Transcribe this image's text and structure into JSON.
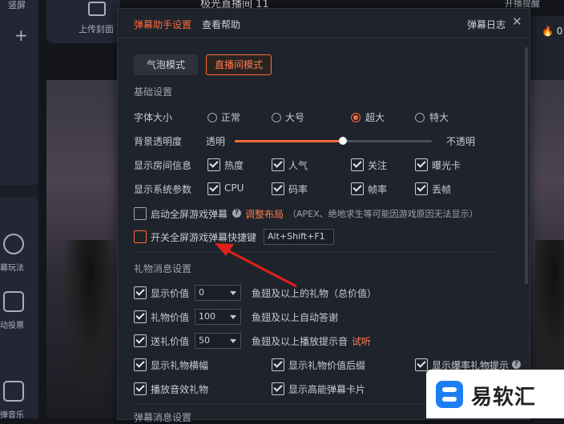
{
  "background": {
    "left_top_label": "竖屏",
    "upload_cover": "上传封面",
    "stream_title": "极光直播间 11",
    "right_top": "开播提醒",
    "right_count": "0",
    "side_items": [
      "幕玩法",
      "动投票",
      "弹音乐"
    ]
  },
  "dialog": {
    "tabs": {
      "settings": "弹幕助手设置",
      "help": "查看帮助"
    },
    "log": "弹幕日志",
    "close": "✕",
    "modes": [
      "气泡模式",
      "直播间模式"
    ],
    "basic": {
      "title": "基础设置",
      "font_label": "字体大小",
      "font_options": [
        "正常",
        "大号",
        "超大",
        "特大"
      ],
      "font_selected": "超大",
      "opacity_label": "背景透明度",
      "opacity_min": "透明",
      "opacity_max": "不透明",
      "opacity_value": 0.55,
      "room_label": "显示房间信息",
      "room_options": [
        "热度",
        "人气",
        "关注",
        "曝光卡"
      ],
      "sys_label": "显示系统参数",
      "sys_options": [
        "CPU",
        "码率",
        "帧率",
        "丢帧"
      ],
      "fullscreen_label": "启动全屏游戏弹幕",
      "adjust_layout": "调整布局",
      "fullscreen_note": "（APEX、绝地求生等可能因游戏原因无法显示）",
      "hotkey_label": "开关全屏游戏弹幕快捷键",
      "hotkey_value": "Alt+Shift+F1"
    },
    "gift": {
      "title": "礼物消息设置",
      "show_value_label": "显示价值",
      "show_value": "0",
      "show_value_suffix": "鱼翅及以上的礼物（总价值）",
      "gift_value_label": "礼物价值",
      "gift_value": "100",
      "gift_value_suffix": "鱼翅及以上自动答谢",
      "send_value_label": "送礼价值",
      "send_value": "50",
      "send_value_suffix": "鱼翅及以上播放提示音",
      "listen": "试听",
      "banner": "显示礼物横幅",
      "value_suffix": "显示礼物价值后缀",
      "burst": "显示爆率礼物提示",
      "sound_gift": "播放音效礼物",
      "high_card": "显示高能弹幕卡片"
    },
    "next_section": "弹幕消息设置"
  },
  "watermark": "易软汇",
  "colors": {
    "accent": "#ff6a3d",
    "dialog_bg": "#1f232b"
  }
}
